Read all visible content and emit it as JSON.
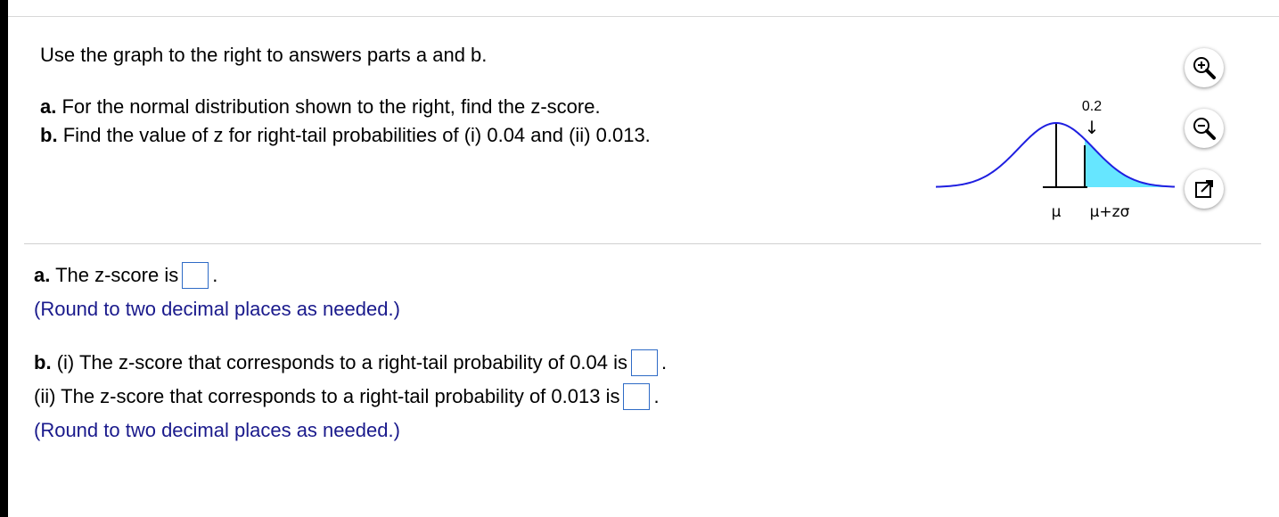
{
  "question": {
    "intro": "Use the graph to the right to answers parts a and b.",
    "part_a_lead": "a.",
    "part_a_text": "For the normal distribution shown to the right, find the z-score.",
    "part_b_lead": "b.",
    "part_b_text": "Find the value of z for right-tail probabilities of (i) 0.04 and (ii) 0.013."
  },
  "figure": {
    "area_label": "0.2",
    "arrow": "↓",
    "mu_label": "μ",
    "mu_plus_label": "μ+zσ",
    "curve_color": "#1f1fe0",
    "shade_color": "#66e6ff"
  },
  "tools": {
    "zoom_in_icon": "zoom-in-icon",
    "zoom_out_icon": "zoom-out-icon",
    "popout_icon": "popout-icon"
  },
  "answers": {
    "a_lead": "a.",
    "a_text": "The z-score is",
    "a_end": ".",
    "a_hint": "(Round to two decimal places as needed.)",
    "b_lead": "b.",
    "b_i_text": "(i) The z-score that corresponds to a right-tail probability of 0.04 is",
    "b_i_end": ".",
    "b_ii_text": "(ii) The z-score that corresponds to a right-tail probability of 0.013 is",
    "b_ii_end": ".",
    "b_hint": "(Round to two decimal places as needed.)"
  }
}
